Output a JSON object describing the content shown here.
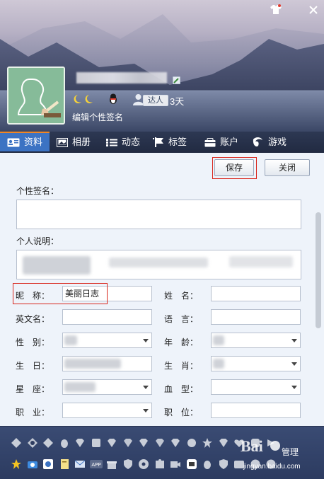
{
  "window": {
    "skin_icon": "tshirt-skin-icon",
    "close_icon": "close-icon"
  },
  "profile": {
    "nickname_blurred": true,
    "status_badge": "达人",
    "days": "3天",
    "edit_signature": "编辑个性签名"
  },
  "tabs": [
    {
      "label": "资料",
      "icon": "profile-card-icon",
      "active": true
    },
    {
      "label": "相册",
      "icon": "photo-album-icon",
      "active": false
    },
    {
      "label": "动态",
      "icon": "feed-list-icon",
      "active": false
    },
    {
      "label": "标签",
      "icon": "tag-icon",
      "active": false
    },
    {
      "label": "账户",
      "icon": "wallet-icon",
      "active": false
    },
    {
      "label": "游戏",
      "icon": "game-icon",
      "active": false
    }
  ],
  "actions": {
    "save": "保存",
    "close": "关闭"
  },
  "form": {
    "signature_label": "个性签名：",
    "description_label": "个人说明：",
    "nickname_label": "昵　称：",
    "nickname_value": "美丽日志",
    "name_label": "姓　名：",
    "english_name_label": "英文名：",
    "language_label": "语　言：",
    "gender_label": "性　别：",
    "age_label": "年　龄：",
    "birthday_label": "生　日：",
    "zodiac_animal_label": "生　肖：",
    "constellation_label": "星　座：",
    "blood_type_label": "血　型：",
    "occupation_label": "职　业：",
    "position_label": "职　位："
  },
  "tray": {
    "manage_label": "管理",
    "watermark_main": "Bai经验",
    "watermark_url": "jingyan.baidu.com"
  },
  "colors": {
    "tab_bar": "#242d45",
    "tab_active": "#3c73c3",
    "tab_active_accent": "#f08624",
    "content_bg": "#eef3fa",
    "highlight_box": "#d9261c",
    "tray_bg": "#33436a"
  }
}
